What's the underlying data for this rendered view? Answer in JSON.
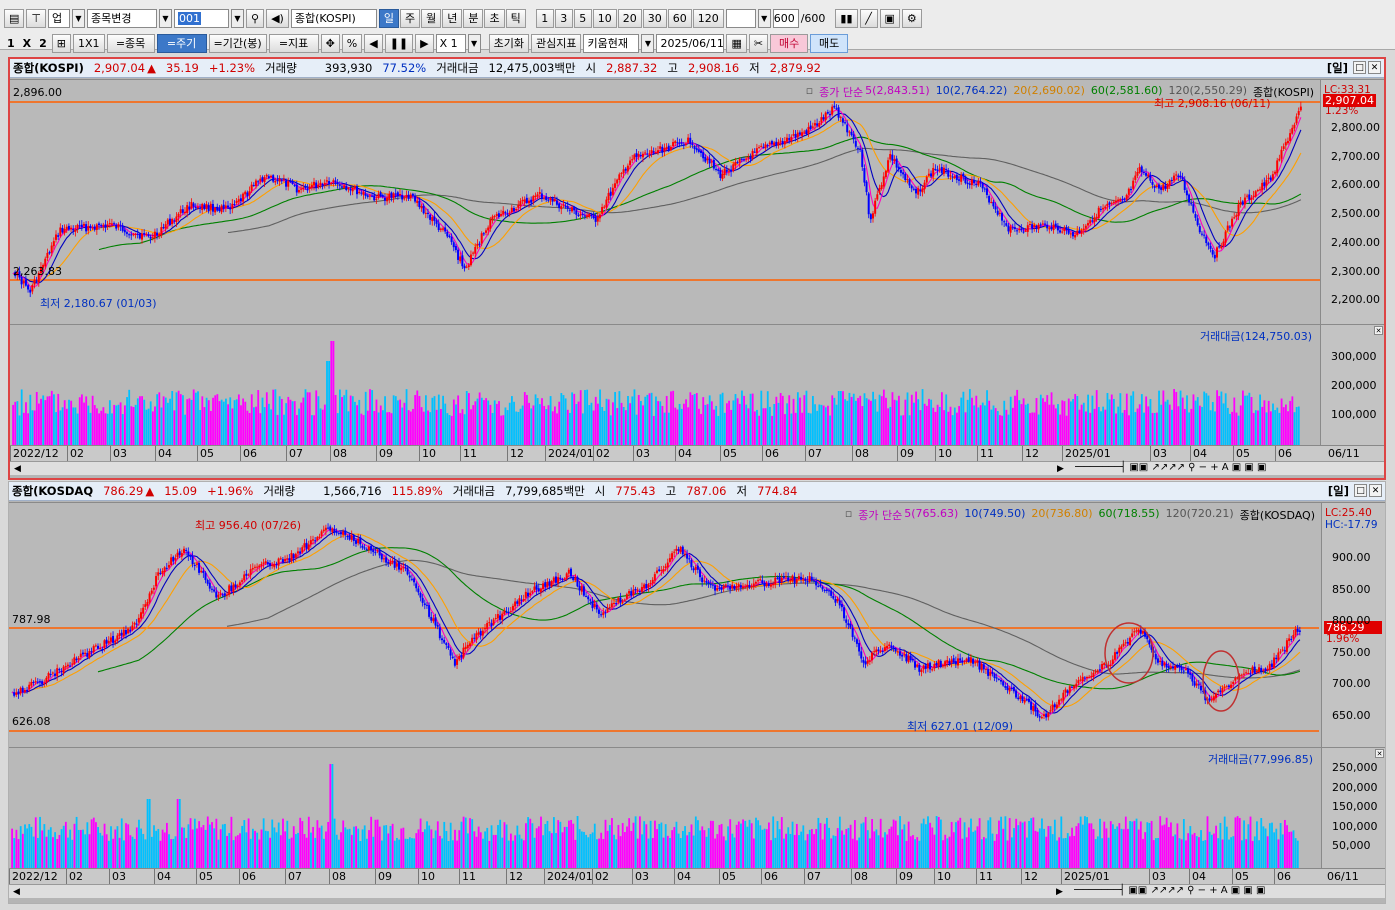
{
  "toolbar": {
    "row1": {
      "type_select": "업",
      "change_stock": "종목변경",
      "code": "001",
      "name": "종합(KOSPI)",
      "periods": [
        "일",
        "주",
        "월",
        "년",
        "분",
        "초",
        "틱"
      ],
      "active_period": "일",
      "minutes": [
        "1",
        "3",
        "5",
        "10",
        "20",
        "30",
        "60",
        "120"
      ],
      "count": "600",
      "count_total": "/600"
    },
    "row2": {
      "layout_a": "1",
      "layout_x": "X",
      "layout_b": "2",
      "grid": "1X1",
      "btn_stock": "=종목",
      "btn_period": "=주기",
      "btn_range": "=기간(봉)",
      "btn_indicator": "=지표",
      "percent": "%",
      "zoom": "X 1",
      "reset": "초기화",
      "watch": "관심지표",
      "kiwoom": "키움현재",
      "date": "2025/06/11",
      "buy": "매수",
      "sell": "매도"
    }
  },
  "kospi": {
    "title": "종합(KOSPI)",
    "price": "2,907.04",
    "arrow": "▲",
    "change": "35.19",
    "pct": "+1.23%",
    "vol_label": "거래량",
    "vol": "393,930",
    "vol_pct": "77.52%",
    "amt_label": "거래대금",
    "amt": "12,475,003백만",
    "open_label": "시",
    "open": "2,887.32",
    "high_label": "고",
    "high": "2,908.16",
    "low_label": "저",
    "low": "2,879.92",
    "period_tag": "[일]",
    "line_top": "2,896.00",
    "line_bottom": "2,263.83",
    "min_note": "최저 2,180.67 (01/03)",
    "max_note": "최고 2,908.16 (06/11)",
    "legend": {
      "type": "종가 단순",
      "ma5": "5(2,843.51)",
      "ma10": "10(2,764.22)",
      "ma20": "20(2,690.02)",
      "ma60": "60(2,581.60)",
      "ma120": "120(2,550.29)",
      "series": "종합(KOSPI)"
    },
    "axis_ticks": [
      "2,800.00",
      "2,700.00",
      "2,600.00",
      "2,500.00",
      "2,400.00",
      "2,300.00",
      "2,200.00"
    ],
    "axis_lc": "LC:33.31",
    "price_tag": "2,907.04",
    "pct_tag": "1.23%",
    "vol_legend": "거래대금(124,750.03)",
    "vol_ticks": [
      "300,000",
      "200,000",
      "100,000"
    ],
    "colors": {
      "up": "#ff0000",
      "down": "#0000ff",
      "ma5": "#ff00c0",
      "ma10": "#0000c0",
      "ma20": "#ffa000",
      "ma60": "#008000",
      "ma120": "#606060",
      "hline": "#ff6000",
      "vol_up": "#ff00ff",
      "vol_down": "#00c0ff"
    }
  },
  "kosdaq": {
    "title": "종합(KOSDAQ",
    "price": "786.29",
    "arrow": "▲",
    "change": "15.09",
    "pct": "+1.96%",
    "vol_label": "거래량",
    "vol": "1,566,716",
    "vol_pct": "115.89%",
    "amt_label": "거래대금",
    "amt": "7,799,685백만",
    "open_label": "시",
    "open": "775.43",
    "high_label": "고",
    "high": "787.06",
    "low_label": "저",
    "low": "774.84",
    "period_tag": "[일]",
    "line_top": "787.98",
    "line_bottom": "626.08",
    "min_note": "최저 627.01 (12/09)",
    "max_note": "최고 956.40 (07/26)",
    "legend": {
      "type": "종가 단순",
      "ma5": "5(765.63)",
      "ma10": "10(749.50)",
      "ma20": "20(736.80)",
      "ma60": "60(718.55)",
      "ma120": "120(720.21)",
      "series": "종합(KOSDAQ)"
    },
    "axis_ticks": [
      "900.00",
      "850.00",
      "800.00",
      "750.00",
      "700.00",
      "650.00"
    ],
    "axis_lc": "LC:25.40",
    "axis_hc": "HC:-17.79",
    "price_tag": "786.29",
    "pct_tag": "1.96%",
    "vol_legend": "거래대금(77,996.85)",
    "vol_ticks": [
      "250,000",
      "200,000",
      "150,000",
      "100,000",
      "50,000"
    ]
  },
  "date_axis": [
    "2022/12",
    "02",
    "03",
    "04",
    "05",
    "06",
    "07",
    "08",
    "09",
    "10",
    "11",
    "12",
    "2024/01",
    "02",
    "03",
    "04",
    "05",
    "06",
    "07",
    "08",
    "09",
    "10",
    "11",
    "12",
    "2025/01",
    "03",
    "04",
    "05",
    "06"
  ],
  "date_axis_end": "06/11"
}
